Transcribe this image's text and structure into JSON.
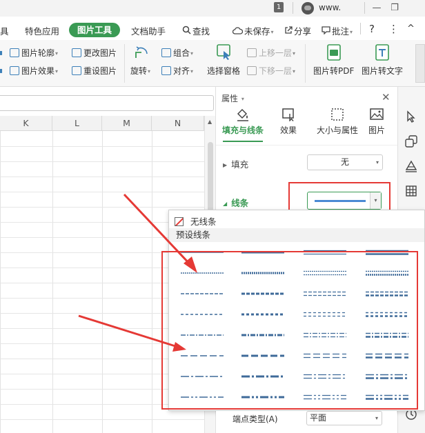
{
  "titlebar": {
    "badge": "1",
    "user": "www.",
    "minimize": "—",
    "restore": "❐"
  },
  "menu": {
    "partial_left": "具",
    "items": [
      "特色应用",
      "图片工具",
      "文档助手",
      "查找"
    ],
    "active_index": 1,
    "right_items": {
      "unsaved": "未保存",
      "share": "分享",
      "annotate": "批注",
      "help": "?",
      "more": "⋮",
      "collapse": "^"
    }
  },
  "ribbon": {
    "outline": "图片轮廓",
    "effect": "图片效果",
    "change_picture": "更改图片",
    "reset_picture": "重设图片",
    "rotate": "旋转",
    "group": "组合",
    "align": "对齐",
    "selection_pane": "选择窗格",
    "bring_forward": "上移一层",
    "send_backward": "下移一层",
    "to_pdf": "图片转PDF",
    "to_text": "图片转文字"
  },
  "sheet": {
    "columns": [
      "K",
      "L",
      "M",
      "N"
    ]
  },
  "panel": {
    "title": "属性",
    "tabs": [
      "填充与线条",
      "效果",
      "大小与属性",
      "图片"
    ],
    "active_tab": 0,
    "fill_label": "填充",
    "fill_value": "无",
    "line_label": "线条",
    "endpoint_label": "端点类型(A)",
    "endpoint_value": "平面"
  },
  "dropdown": {
    "no_line": "无线条",
    "preset_header": "预设线条"
  },
  "colors": {
    "accent_green": "#3a9a54",
    "highlight_red": "#e53935",
    "line_blue": "#4a8ad4",
    "dash_color": "#3e6a99"
  }
}
